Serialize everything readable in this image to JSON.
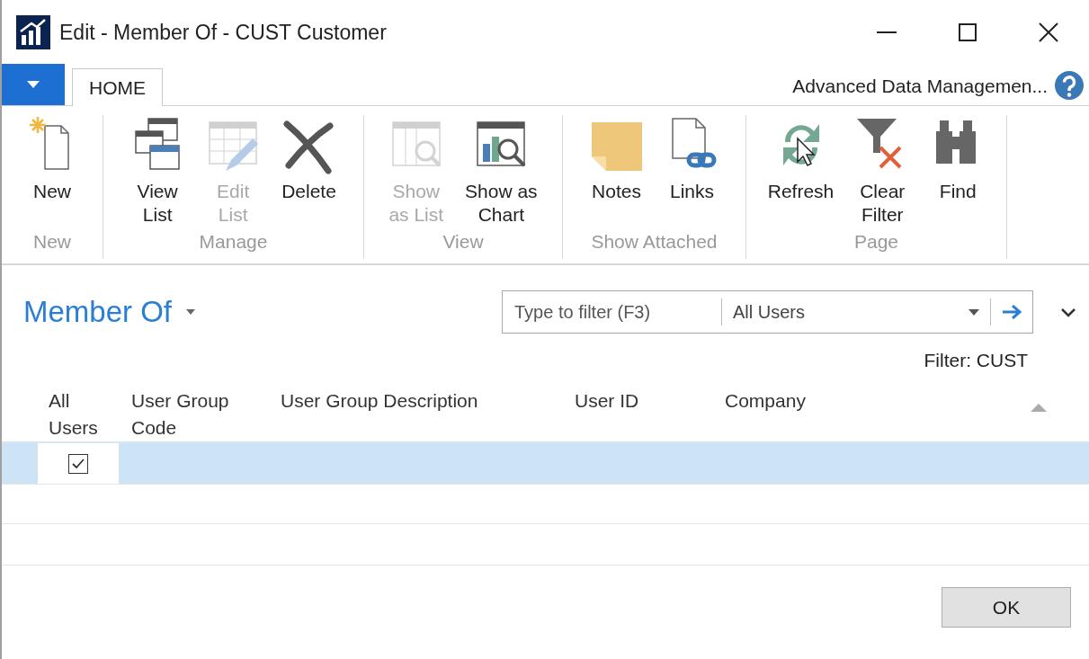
{
  "window": {
    "title": "Edit - Member Of - CUST Customer"
  },
  "ribbon_tabs": [
    {
      "label": "HOME",
      "selected": true
    }
  ],
  "company": "Advanced Data Managemen...",
  "ribbon_groups": [
    {
      "label": "New",
      "buttons": [
        {
          "label_lines": [
            "New"
          ],
          "disabled": false
        }
      ]
    },
    {
      "label": "Manage",
      "buttons": [
        {
          "label_lines": [
            "View",
            "List"
          ],
          "disabled": false
        },
        {
          "label_lines": [
            "Edit",
            "List"
          ],
          "disabled": true
        },
        {
          "label_lines": [
            "Delete"
          ],
          "disabled": false
        }
      ]
    },
    {
      "label": "View",
      "buttons": [
        {
          "label_lines": [
            "Show",
            "as List"
          ],
          "disabled": true
        },
        {
          "label_lines": [
            "Show as",
            "Chart"
          ],
          "disabled": false
        }
      ]
    },
    {
      "label": "Show Attached",
      "buttons": [
        {
          "label_lines": [
            "Notes"
          ],
          "disabled": false
        },
        {
          "label_lines": [
            "Links"
          ],
          "disabled": false
        }
      ]
    },
    {
      "label": "Page",
      "buttons": [
        {
          "label_lines": [
            "Refresh"
          ],
          "disabled": false
        },
        {
          "label_lines": [
            "Clear",
            "Filter"
          ],
          "disabled": false
        },
        {
          "label_lines": [
            "Find"
          ],
          "disabled": false
        }
      ]
    }
  ],
  "page_title": "Member Of",
  "filter": {
    "placeholder": "Type to filter (F3)",
    "field": "All Users"
  },
  "filter_note": "Filter: CUST",
  "table": {
    "columns": [
      [
        "All",
        "Users"
      ],
      [
        "User Group",
        "Code"
      ],
      [
        "User Group Description"
      ],
      [
        "User ID"
      ],
      [
        "Company"
      ]
    ],
    "rows": [
      {
        "all_users": true,
        "selected": true
      }
    ]
  },
  "buttons": [
    "OK"
  ]
}
